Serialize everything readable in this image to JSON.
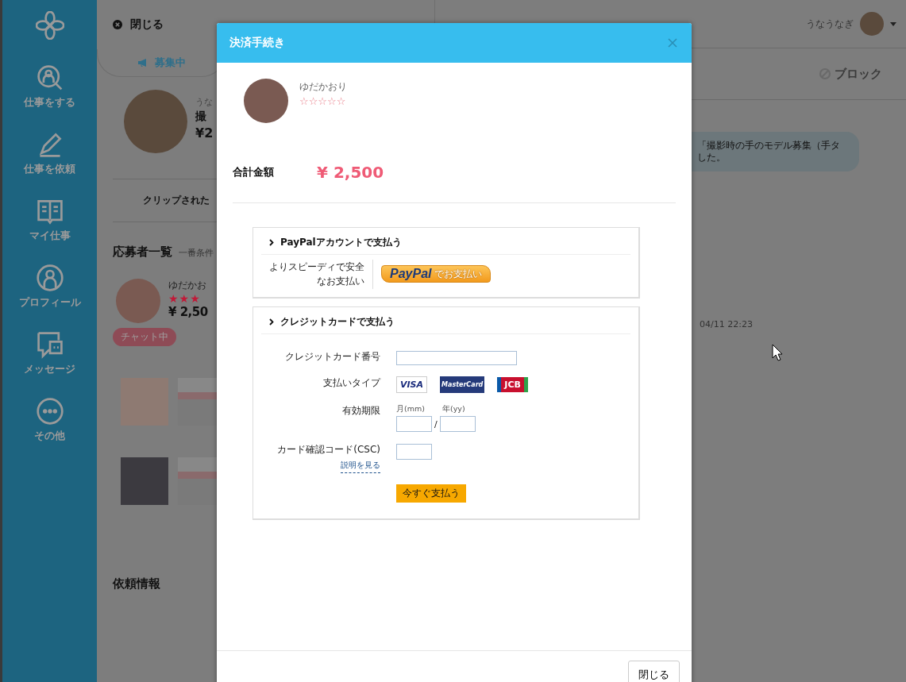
{
  "sidebar": {
    "items": [
      {
        "label": "仕事をする"
      },
      {
        "label": "仕事を依頼"
      },
      {
        "label": "マイ仕事"
      },
      {
        "label": "プロフィール"
      },
      {
        "label": "メッセージ"
      },
      {
        "label": "その他"
      }
    ]
  },
  "left_panel": {
    "close_label": "閉じる",
    "tab": {
      "label": "募集中",
      "selected": true
    },
    "job": {
      "owner": "うな",
      "title": "撮",
      "price": "¥2"
    },
    "clip_label": "クリップされた",
    "applicants_title": "応募者一覧",
    "applicants_note": "一番条件",
    "applicant": {
      "name": "ゆだかお",
      "stars": 3,
      "price": "¥ 2,50",
      "status": "チャット中"
    },
    "request_title": "依頼情報"
  },
  "header": {
    "user_name": "うなうなぎ"
  },
  "chat": {
    "block_label": "ブロック",
    "message_lines": [
      "「撮影時の手のモデル募集（手タ",
      "した。"
    ],
    "timestamp": "04/11 22:23"
  },
  "dialog": {
    "title": "決済手続き",
    "user": {
      "name": "ゆだかおり",
      "stars": 0
    },
    "total_label": "合計金額",
    "total": "¥ 2,500",
    "paypal": {
      "heading": "PayPalアカウントで支払う",
      "description": "よりスピーディで安全なお支払い",
      "button_logo": "PayPal",
      "button_text": "でお支払い"
    },
    "card": {
      "heading": "クレジットカードで支払う",
      "number_label": "クレジットカード番号",
      "type_label": "支払いタイプ",
      "brands": [
        "VISA",
        "MasterCard",
        "JCB"
      ],
      "expiry_label": "有効期限",
      "month_label": "月(mm)",
      "year_label": "年(yy)",
      "separator": "/",
      "csc_label": "カード確認コード(CSC)",
      "csc_help": "説明を見る",
      "pay_button": "今すぐ支払う"
    },
    "close_button": "閉じる"
  }
}
